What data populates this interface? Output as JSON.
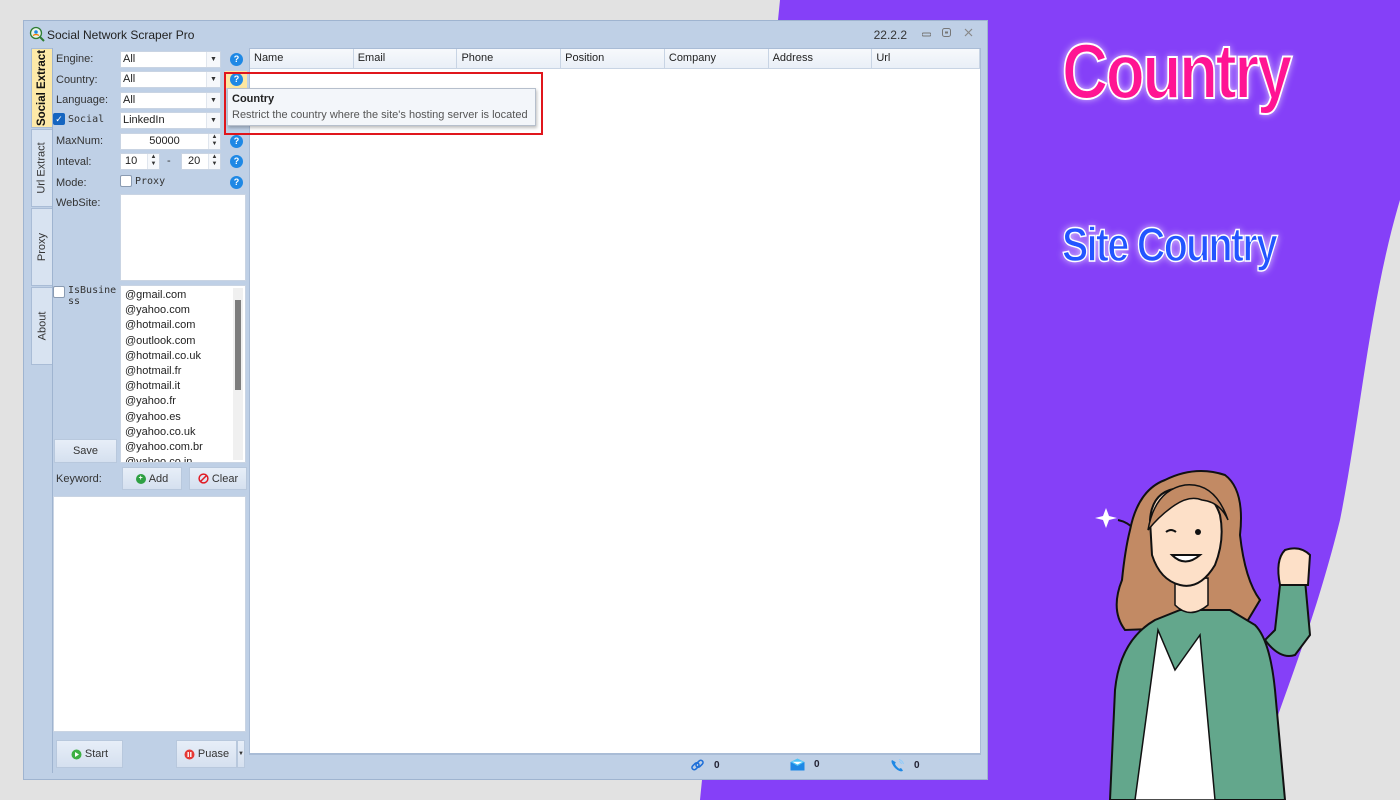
{
  "window": {
    "title": "Social Network Scraper Pro",
    "version": "22.2.2",
    "controls": {
      "minimize": "−",
      "maximize": "▣",
      "close": "✕"
    }
  },
  "tabs": [
    {
      "label": "Social Extract",
      "active": true
    },
    {
      "label": "Url Extract",
      "active": false
    },
    {
      "label": "Proxy",
      "active": false
    },
    {
      "label": "About",
      "active": false
    }
  ],
  "form": {
    "engine": {
      "label": "Engine:",
      "value": "All"
    },
    "country": {
      "label": "Country:",
      "value": "All"
    },
    "language": {
      "label": "Language:",
      "value": "All"
    },
    "social": {
      "label": "Social",
      "checked": true,
      "value": "LinkedIn"
    },
    "maxnum": {
      "label": "MaxNum:",
      "value": "50000"
    },
    "interval": {
      "label": "Inteval:",
      "from": "10",
      "separator": "-",
      "to": "20"
    },
    "mode": {
      "label": "Mode:",
      "proxy_label": "Proxy",
      "proxy_checked": false
    },
    "website": {
      "label": "WebSite:",
      "value": ""
    },
    "is_business": {
      "label": "IsBusiness",
      "label_line1": "IsBusine",
      "label_line2": "ss",
      "checked": false
    },
    "domains": [
      "@gmail.com",
      "@yahoo.com",
      "@hotmail.com",
      "@outlook.com",
      "@hotmail.co.uk",
      "@hotmail.fr",
      "@hotmail.it",
      "@yahoo.fr",
      "@yahoo.es",
      "@yahoo.co.uk",
      "@yahoo.com.br",
      "@yahoo.co.in"
    ],
    "save_label": "Save",
    "keyword": {
      "label": "Keyword:",
      "add_label": "Add",
      "clear_label": "Clear",
      "value": ""
    },
    "start_label": "Start",
    "pause_label": "Puase",
    "help_glyph": "?"
  },
  "grid": {
    "columns": [
      "Name",
      "Email",
      "Phone",
      "Position",
      "Company",
      "Address",
      "Url"
    ],
    "rows": []
  },
  "tooltip": {
    "title": "Country",
    "body": "Restrict the country where the site's hosting server is located"
  },
  "status": {
    "links": "0",
    "emails": "0",
    "phones": "0"
  },
  "promo": {
    "title": "Country",
    "subtitle": "Site Country",
    "colors": {
      "background": "#8540f8",
      "title": "#ff1493",
      "subtitle": "#2255ff",
      "highlight": "#e0161c"
    }
  }
}
